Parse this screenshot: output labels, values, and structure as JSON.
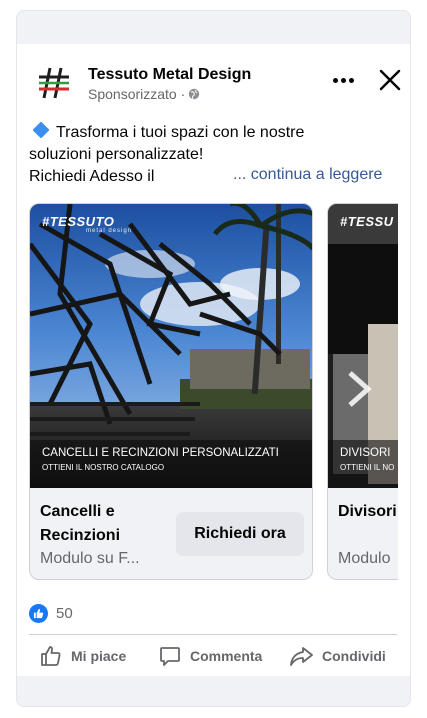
{
  "post": {
    "advertiser": "Tessuto Metal Design",
    "sponsored": "Sponsorizzato ·",
    "text_line1": "Trasforma i tuoi spazi con le nostre",
    "text_line2": "soluzioni personalizzate!",
    "text_line3": "Richiedi Adesso il",
    "see_more": "... continua a leggere"
  },
  "carousel": [
    {
      "brand": "#TESSUTO",
      "brand_sub": "metal design",
      "caption": "CANCELLI E RECINZIONI PERSONALIZZATI",
      "caption_sub": "OTTIENI IL NOSTRO CATALOGO",
      "title": "Cancelli e Recinzioni",
      "description": "Modulo su F...",
      "cta": "Richiedi ora"
    },
    {
      "brand": "#TESSU",
      "caption": "DIVISORI",
      "caption_sub": "OTTIENI IL NO",
      "title": "Divisori Interni",
      "description": "Modulo"
    }
  ],
  "reactions": {
    "count": "50"
  },
  "actions": {
    "like": "Mi piace",
    "comment": "Commenta",
    "share": "Condividi"
  },
  "colors": {
    "accent": "#1877f2",
    "link": "#385898",
    "muted": "#65676b",
    "diamond": "#3b8ff0"
  },
  "icons": [
    "logo-hash-icon",
    "globe-icon",
    "more-icon",
    "close-icon",
    "diamond-icon",
    "chevron-right-icon",
    "like-reaction-icon",
    "thumbs-up-icon",
    "comment-icon",
    "share-icon"
  ]
}
